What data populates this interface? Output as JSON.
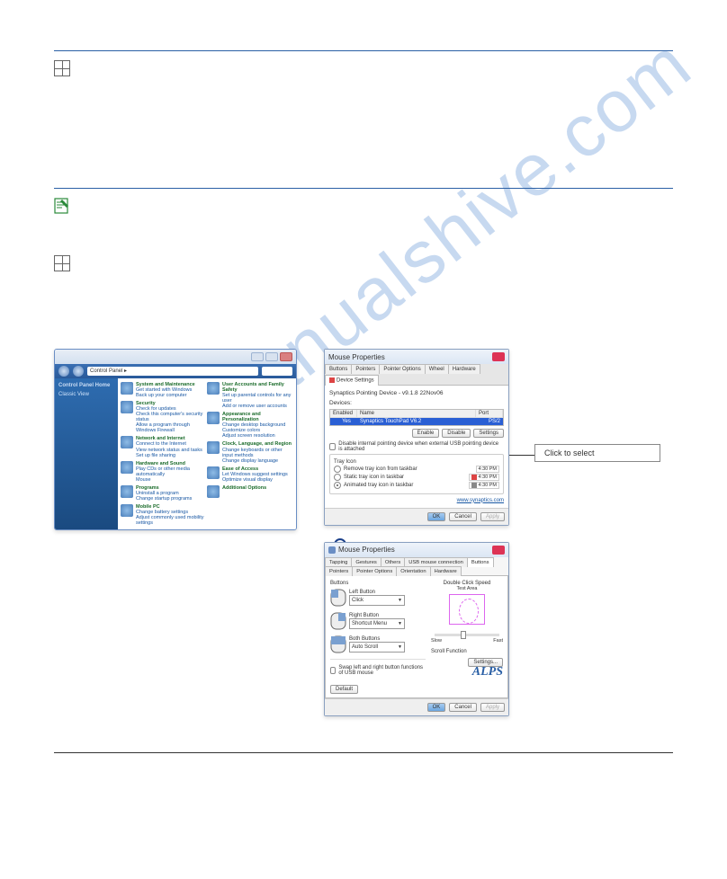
{
  "watermark": "manualshive.com",
  "step1_text": "",
  "note_text": "",
  "step2_text": "",
  "callout_label": "Click to select",
  "cp": {
    "address": "Control Panel ▸",
    "side_title": "Control Panel Home",
    "side_link": "Classic View",
    "items_left": [
      {
        "title": "System and Maintenance",
        "subs": [
          "Get started with Windows",
          "Back up your computer"
        ]
      },
      {
        "title": "Security",
        "subs": [
          "Check for updates",
          "Check this computer's security status",
          "Allow a program through Windows Firewall"
        ]
      },
      {
        "title": "Network and Internet",
        "subs": [
          "Connect to the Internet",
          "View network status and tasks",
          "Set up file sharing"
        ]
      },
      {
        "title": "Hardware and Sound",
        "subs": [
          "Play CDs or other media automatically",
          "Mouse"
        ]
      },
      {
        "title": "Programs",
        "subs": [
          "Uninstall a program",
          "Change startup programs"
        ]
      },
      {
        "title": "Mobile PC",
        "subs": [
          "Change battery settings",
          "Adjust commonly used mobility settings"
        ]
      }
    ],
    "items_right": [
      {
        "title": "User Accounts and Family Safety",
        "subs": [
          "Set up parental controls for any user",
          "Add or remove user accounts"
        ]
      },
      {
        "title": "Appearance and Personalization",
        "subs": [
          "Change desktop background",
          "Customize colors",
          "Adjust screen resolution"
        ]
      },
      {
        "title": "Clock, Language, and Region",
        "subs": [
          "Change keyboards or other input methods",
          "Change display language"
        ]
      },
      {
        "title": "Ease of Access",
        "subs": [
          "Let Windows suggest settings",
          "Optimize visual display"
        ]
      },
      {
        "title": "Additional Options",
        "subs": []
      }
    ]
  },
  "syn": {
    "title": "Mouse Properties",
    "tabs": [
      "Buttons",
      "Pointers",
      "Pointer Options",
      "Wheel",
      "Hardware",
      "Device Settings"
    ],
    "active_tab": "Device Settings",
    "device_line": "Synaptics Pointing Device - v9.1.8 22Nov06",
    "devices_label": "Devices:",
    "cols": {
      "c1": "Enabled",
      "c2": "Name",
      "c3": "Port"
    },
    "dev_row": {
      "name": "Synaptics TouchPad V6.2",
      "port": "PS/2"
    },
    "btns": {
      "enable": "Enable",
      "disable": "Disable",
      "settings": "Settings"
    },
    "disable_ext": "Disable internal pointing device when external USB pointing device is attached",
    "tray_label": "Tray Icon",
    "tray_opts": [
      "Remove tray icon from taskbar",
      "Static tray icon in taskbar",
      "Animated tray icon in taskbar"
    ],
    "time": "4:30 PM",
    "link": "www.synaptics.com",
    "footer": {
      "ok": "OK",
      "cancel": "Cancel",
      "apply": "Apply"
    }
  },
  "alps": {
    "title": "Mouse Properties",
    "tabs_row1": [
      "Tapping",
      "Gestures",
      "Others",
      "USB mouse connection"
    ],
    "tabs_row2": [
      "Buttons",
      "Pointers",
      "Pointer Options",
      "Orientation",
      "Hardware"
    ],
    "active_tab": "Buttons",
    "buttons_label": "Buttons",
    "left_label": "Left Button",
    "left_sel": "Click",
    "right_label": "Right Button",
    "right_sel": "Shortcut Menu",
    "both_label": "Both Buttons",
    "both_sel": "Auto Scroll",
    "swap_label": "Swap left and right button functions of USB mouse",
    "dcs_label": "Double Click Speed",
    "dcs_sub": "Test Area",
    "slow": "Slow",
    "fast": "Fast",
    "scroll_label": "Scroll Function",
    "settings_btn": "Settings...",
    "default_btn": "Default",
    "logo": "ALPS",
    "footer": {
      "ok": "OK",
      "cancel": "Cancel",
      "apply": "Apply"
    }
  }
}
